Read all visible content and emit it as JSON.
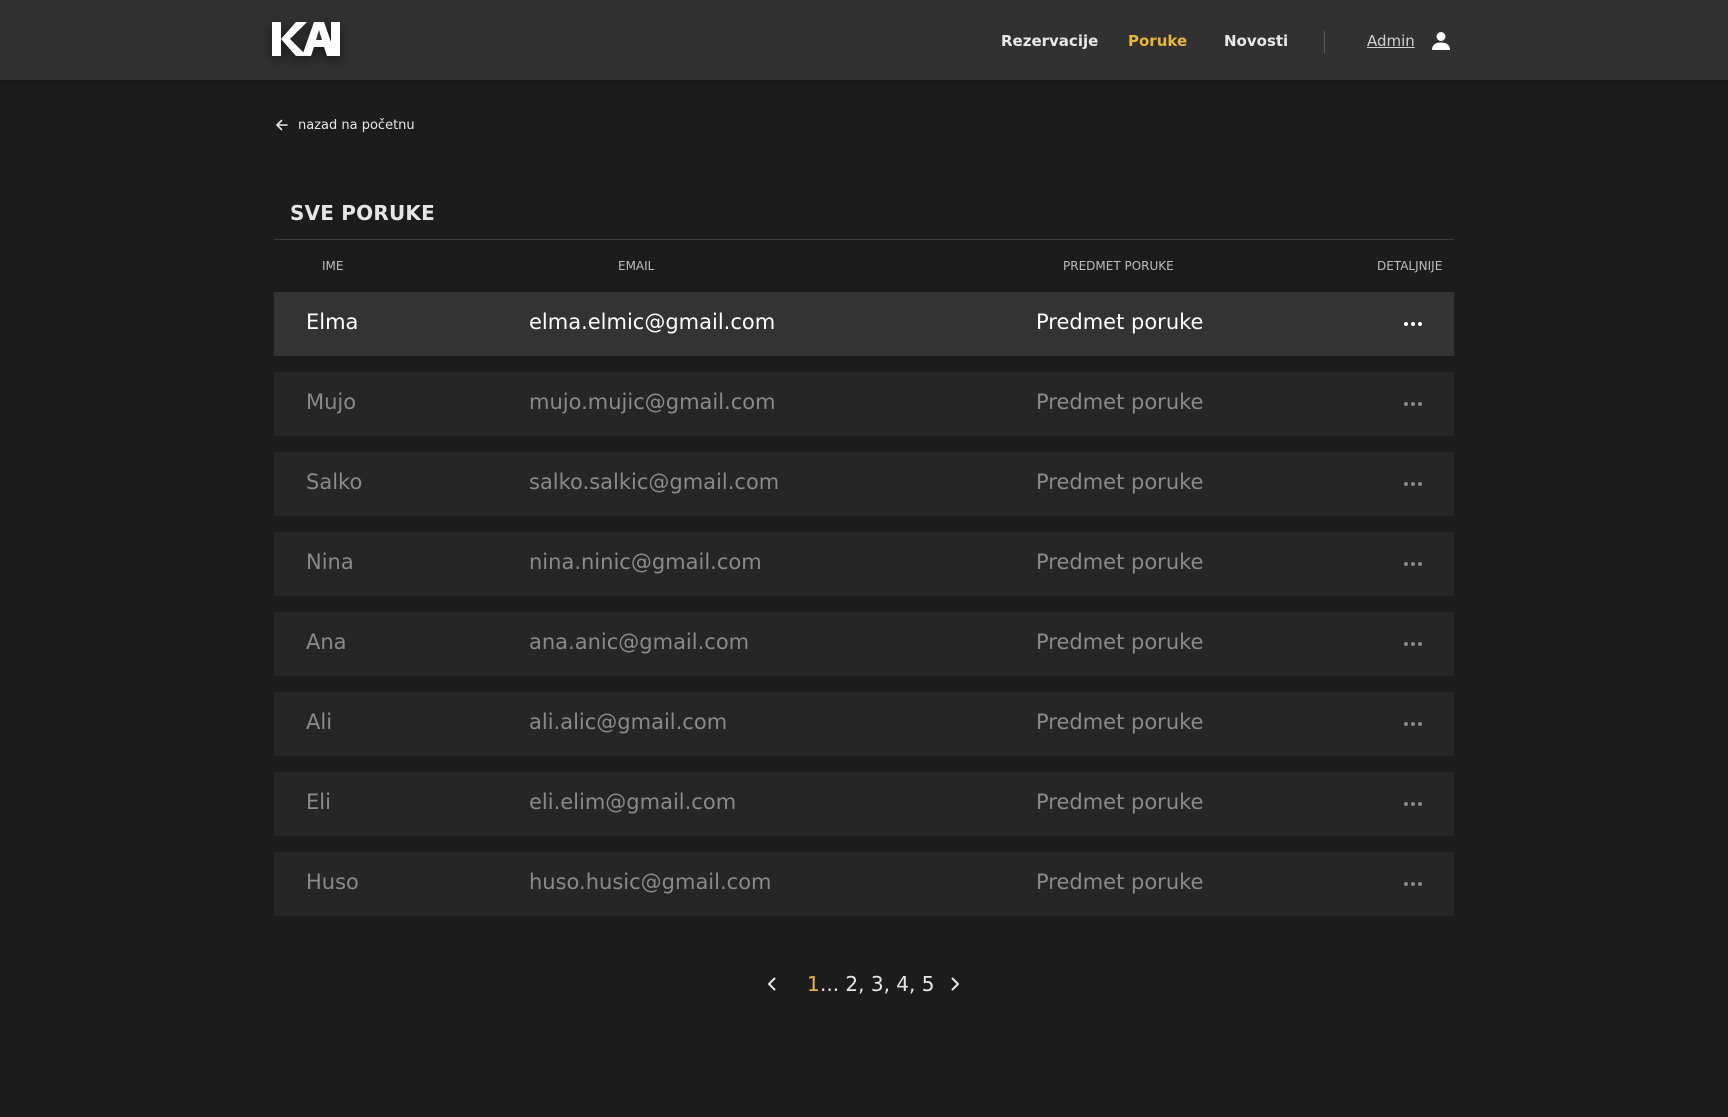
{
  "brand": {
    "logo_text": "KAI"
  },
  "nav": {
    "items": [
      {
        "label": "Rezervacije",
        "active": false
      },
      {
        "label": "Poruke",
        "active": true
      },
      {
        "label": "Novosti",
        "active": false
      }
    ],
    "admin_label": "Admin",
    "active_color": "#e9b53a"
  },
  "back_link": {
    "label": "nazad na početnu",
    "icon": "arrow-left-icon"
  },
  "table": {
    "title": "SVE PORUKE",
    "columns": [
      "IME",
      "EMAIL",
      "PREDMET PORUKE",
      "DETALJNIJE"
    ],
    "selected_row": 0,
    "rows": [
      {
        "name": "Elma",
        "email": "elma.elmic@gmail.com",
        "subject": "Predmet poruke"
      },
      {
        "name": "Mujo",
        "email": "mujo.mujic@gmail.com",
        "subject": "Predmet poruke"
      },
      {
        "name": "Salko",
        "email": "salko.salkic@gmail.com",
        "subject": "Predmet poruke"
      },
      {
        "name": "Nina",
        "email": "nina.ninic@gmail.com",
        "subject": "Predmet poruke"
      },
      {
        "name": "Ana",
        "email": "ana.anic@gmail.com",
        "subject": "Predmet poruke"
      },
      {
        "name": "Ali",
        "email": "ali.alic@gmail.com",
        "subject": "Predmet poruke"
      },
      {
        "name": "Eli",
        "email": "eli.elim@gmail.com",
        "subject": "Predmet poruke"
      },
      {
        "name": "Huso",
        "email": "huso.husic@gmail.com",
        "subject": "Predmet poruke"
      }
    ],
    "details_icon": "more-horizontal-icon"
  },
  "pagination": {
    "current": "1",
    "rest": "... 2, 3, 4, 5",
    "prev_icon": "chevron-left-icon",
    "next_icon": "chevron-right-icon"
  }
}
